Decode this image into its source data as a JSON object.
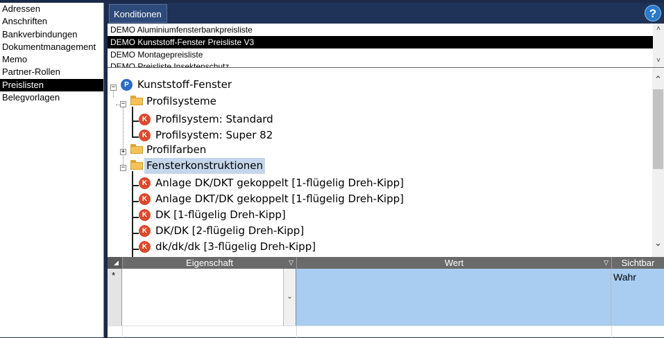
{
  "sidebar": {
    "items": [
      {
        "label": "Adressen"
      },
      {
        "label": "Anschriften"
      },
      {
        "label": "Bankverbindungen"
      },
      {
        "label": "Dokumentmanagement"
      },
      {
        "label": "Memo"
      },
      {
        "label": "Partner-Rollen"
      },
      {
        "label": "Preislisten"
      },
      {
        "label": "Belegvorlagen"
      }
    ],
    "selected_index": 6
  },
  "header": {
    "tab_label": "Konditionen",
    "help_label": "?"
  },
  "price_lists": {
    "items": [
      "DEMO Aluminiumfensterbankpreisliste",
      "DEMO Kunststoff-Fenster Preisliste V3",
      "DEMO Montagepreisliste",
      "DEMO Preisliste Insektenschutz"
    ],
    "selected_index": 1,
    "scroll_up": "˄",
    "scroll_down": "˅"
  },
  "tree": {
    "root": {
      "badge": "P",
      "label": "Kunststoff-Fenster"
    },
    "nodes": [
      {
        "kind": "folder",
        "label": "Profilsysteme",
        "expander": "−"
      },
      {
        "kind": "item",
        "badge": "K",
        "label": "Profilsystem: Standard"
      },
      {
        "kind": "item",
        "badge": "K",
        "label": "Profilsystem: Super 82"
      },
      {
        "kind": "folder",
        "label": "Profilfarben",
        "expander": "+"
      },
      {
        "kind": "folder",
        "label": "Fensterkonstruktionen",
        "expander": "−",
        "highlighted": true
      },
      {
        "kind": "item",
        "badge": "K",
        "label": "Anlage DK/DKT gekoppelt [1-flügelig Dreh-Kipp]"
      },
      {
        "kind": "item",
        "badge": "K",
        "label": "Anlage DKT/DK gekoppelt [1-flügelig Dreh-Kipp]"
      },
      {
        "kind": "item",
        "badge": "K",
        "label": "DK [1-flügelig Dreh-Kipp]"
      },
      {
        "kind": "item",
        "badge": "K",
        "label": "DK/DK [2-flügelig Dreh-Kipp]"
      },
      {
        "kind": "item",
        "badge": "K",
        "label": "dk/dk/dk [3-flügelig Dreh-Kipp]"
      }
    ],
    "root_expander": "−",
    "scroll_up": "⌃",
    "scroll_down": "⌄"
  },
  "property_grid": {
    "columns": {
      "eigenschaft": "Eigenschaft",
      "wert": "Wert",
      "sichtbar": "Sichtbar"
    },
    "new_row_marker": "*",
    "row": {
      "eigenschaft": "",
      "wert": "",
      "sichtbar": "Wahr"
    },
    "dropdown_glyph": "⌄",
    "header_dropdown_glyph": "▽",
    "corner_glyph": "◢"
  },
  "colors": {
    "frame": "#1b2a4a",
    "selection": "#000000",
    "wert_cell": "#a8cdf0",
    "badge_k": "#d94a2e",
    "badge_p": "#2b6cc4",
    "folder": "#f2c457"
  }
}
